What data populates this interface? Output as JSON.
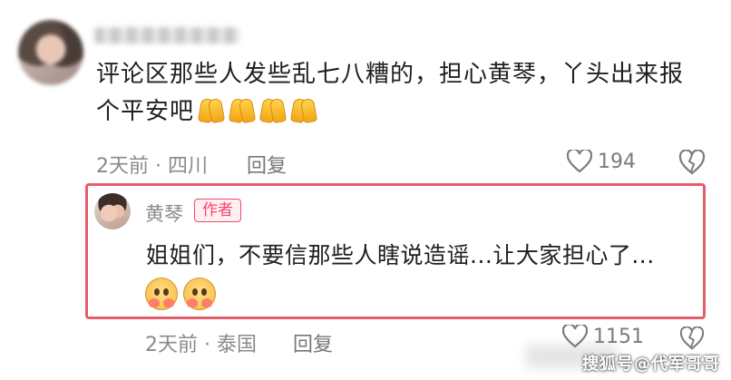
{
  "comment": {
    "text_line1": "评论区那些人发些乱七八糟的，担心黄琴，丫头出来报",
    "text_line2": "个平安吧",
    "emojis": [
      "pray-emoji",
      "pray-emoji",
      "pray-emoji",
      "pray-emoji"
    ],
    "time_location": "2天前 · 四川",
    "reply_label": "回复",
    "like_count": "194"
  },
  "reply": {
    "username": "黄琴",
    "badge": "作者",
    "text": "姐姐们，不要信那些人瞎说造谣...让大家担心了...",
    "emojis": [
      "hearts-face-emoji",
      "hearts-face-emoji"
    ],
    "time_location": "2天前 · 泰国",
    "reply_label": "回复",
    "like_count": "1151"
  },
  "watermark": "搜狐号@代军哥哥",
  "colors": {
    "highlight_border": "#e65c6b",
    "author_badge": "#f04a6a",
    "meta_text": "#8a8a8a"
  }
}
